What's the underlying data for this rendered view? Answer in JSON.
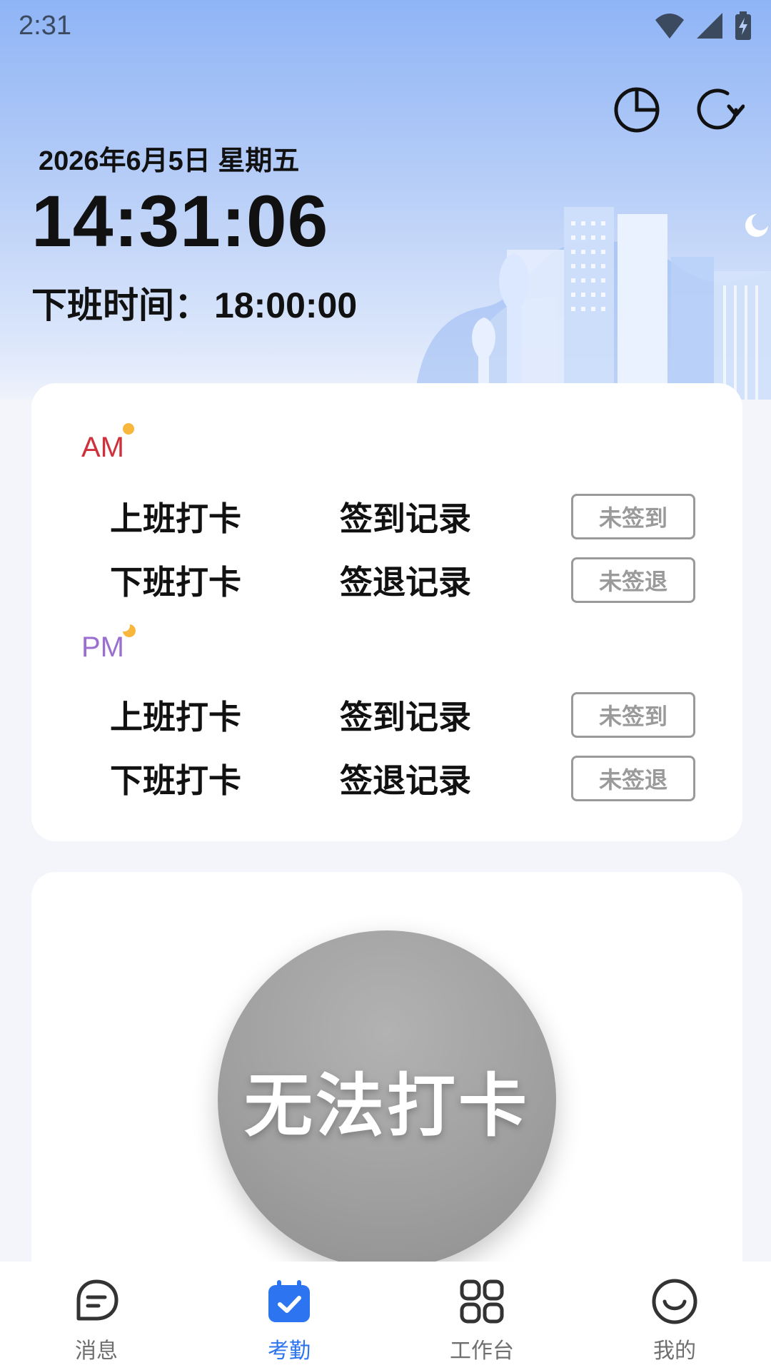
{
  "status_bar": {
    "time": "2:31"
  },
  "header": {
    "date": "2026年6月5日 星期五",
    "clock": "14:31:06",
    "offwork_label": "下班时间：",
    "offwork_time": "18:00:00"
  },
  "records": {
    "am_label": "AM",
    "pm_label": "PM",
    "am_rows": [
      {
        "action": "上班打卡",
        "type": "签到记录",
        "status": "未签到"
      },
      {
        "action": "下班打卡",
        "type": "签退记录",
        "status": "未签退"
      }
    ],
    "pm_rows": [
      {
        "action": "上班打卡",
        "type": "签到记录",
        "status": "未签到"
      },
      {
        "action": "下班打卡",
        "type": "签退记录",
        "status": "未签退"
      }
    ]
  },
  "punch": {
    "label": "无法打卡"
  },
  "tabbar": {
    "items": [
      {
        "label": "消息",
        "icon": "message-icon"
      },
      {
        "label": "考勤",
        "icon": "attendance-calendar-icon"
      },
      {
        "label": "工作台",
        "icon": "workbench-grid-icon"
      },
      {
        "label": "我的",
        "icon": "smile-profile-icon"
      }
    ],
    "active_index": 1,
    "active_color": "#2d74f0",
    "inactive_color": "#6f6f6f"
  },
  "colors": {
    "am_logo": "#d0303a",
    "pm_logo": "#9a6fd0",
    "status_border": "#9a9a9a",
    "punch_button": "#a0a0a0"
  }
}
